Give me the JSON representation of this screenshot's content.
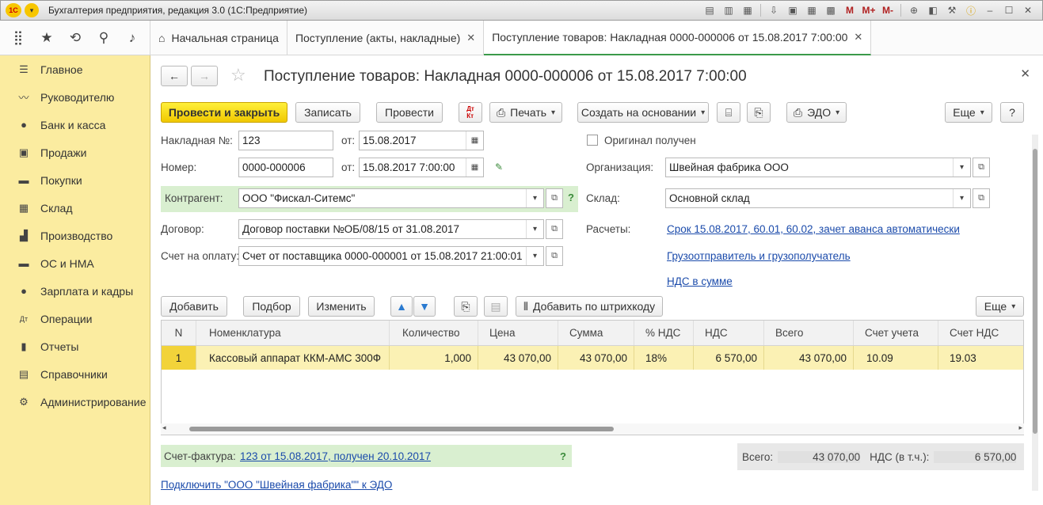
{
  "window": {
    "title": "Бухгалтерия предприятия, редакция 3.0  (1С:Предприятие)",
    "logo": "1С"
  },
  "title_toolbar": [
    "save-icon",
    "print-icon",
    "preview-icon",
    "download-icon",
    "printer2-icon",
    "calc-icon",
    "calendar-icon",
    "M",
    "M+",
    "M-",
    "zoom-icon",
    "panel-icon",
    "wrench-icon",
    "info-icon"
  ],
  "tabs": [
    {
      "label": "Начальная страница"
    },
    {
      "label": "Поступление (акты, накладные)"
    },
    {
      "label": "Поступление товаров: Накладная 0000-000006 от 15.08.2017 7:00:00"
    }
  ],
  "sidebar": {
    "items": [
      {
        "label": "Главное",
        "icon": "☰"
      },
      {
        "label": "Руководителю",
        "icon": "〰"
      },
      {
        "label": "Банк и касса",
        "icon": "●"
      },
      {
        "label": "Продажи",
        "icon": "▣"
      },
      {
        "label": "Покупки",
        "icon": "▬"
      },
      {
        "label": "Склад",
        "icon": "▦"
      },
      {
        "label": "Производство",
        "icon": "▟"
      },
      {
        "label": "ОС и НМА",
        "icon": "▬"
      },
      {
        "label": "Зарплата и кадры",
        "icon": "●"
      },
      {
        "label": "Операции",
        "icon": "Дт"
      },
      {
        "label": "Отчеты",
        "icon": "▮"
      },
      {
        "label": "Справочники",
        "icon": "▤"
      },
      {
        "label": "Администрирование",
        "icon": "⚙"
      }
    ]
  },
  "doc": {
    "title": "Поступление товаров: Накладная 0000-000006 от 15.08.2017 7:00:00",
    "toolbar": {
      "post_close": "Провести и закрыть",
      "write": "Записать",
      "post": "Провести",
      "print": "Печать",
      "create_based": "Создать на основании",
      "edo": "ЭДО",
      "more": "Еще",
      "help": "?"
    },
    "fields": {
      "invoice_no_label": "Накладная №:",
      "invoice_no": "123",
      "from_label": "от:",
      "invoice_date": "15.08.2017",
      "number_label": "Номер:",
      "number": "0000-000006",
      "number_date": "15.08.2017  7:00:00",
      "original_label": "Оригинал получен",
      "org_label": "Организация:",
      "org": "Швейная фабрика ООО",
      "counterparty_label": "Контрагент:",
      "counterparty": "ООО \"Фискал-Ситемс\"",
      "warehouse_label": "Склад:",
      "warehouse": "Основной склад",
      "contract_label": "Договор:",
      "contract": "Договор поставки №ОБ/08/15 от 31.08.2017",
      "settlements_label": "Расчеты:",
      "settlements_link": "Срок 15.08.2017, 60.01, 60.02, зачет аванса автоматически",
      "payment_label": "Счет на оплату:",
      "payment": "Счет от поставщика 0000-000001 от 15.08.2017 21:00:01",
      "consignor_link": "Грузоотправитель и грузополучатель",
      "vat_link": "НДС в сумме"
    },
    "table_toolbar": {
      "add": "Добавить",
      "select": "Подбор",
      "edit": "Изменить",
      "barcode": "Добавить по штрихкоду",
      "more": "Еще"
    },
    "table": {
      "columns": [
        "N",
        "Номенклатура",
        "Количество",
        "Цена",
        "Сумма",
        "% НДС",
        "НДС",
        "Всего",
        "Счет учета",
        "Счет НДС"
      ],
      "rows": [
        [
          "1",
          "Кассовый аппарат ККМ-АМС 300Ф",
          "1,000",
          "43 070,00",
          "43 070,00",
          "18%",
          "6 570,00",
          "43 070,00",
          "10.09",
          "19.03"
        ]
      ]
    },
    "invoice_label": "Счет-фактура:",
    "invoice_link": "123 от 15.08.2017, получен 20.10.2017",
    "invoice_q": "?",
    "totals": {
      "total_label": "Всего:",
      "total": "43 070,00",
      "vat_label": "НДС (в т.ч.):",
      "vat": "6 570,00"
    },
    "edo_link": "Подключить \"ООО \"Швейная фабрика\"\" к ЭДО"
  }
}
